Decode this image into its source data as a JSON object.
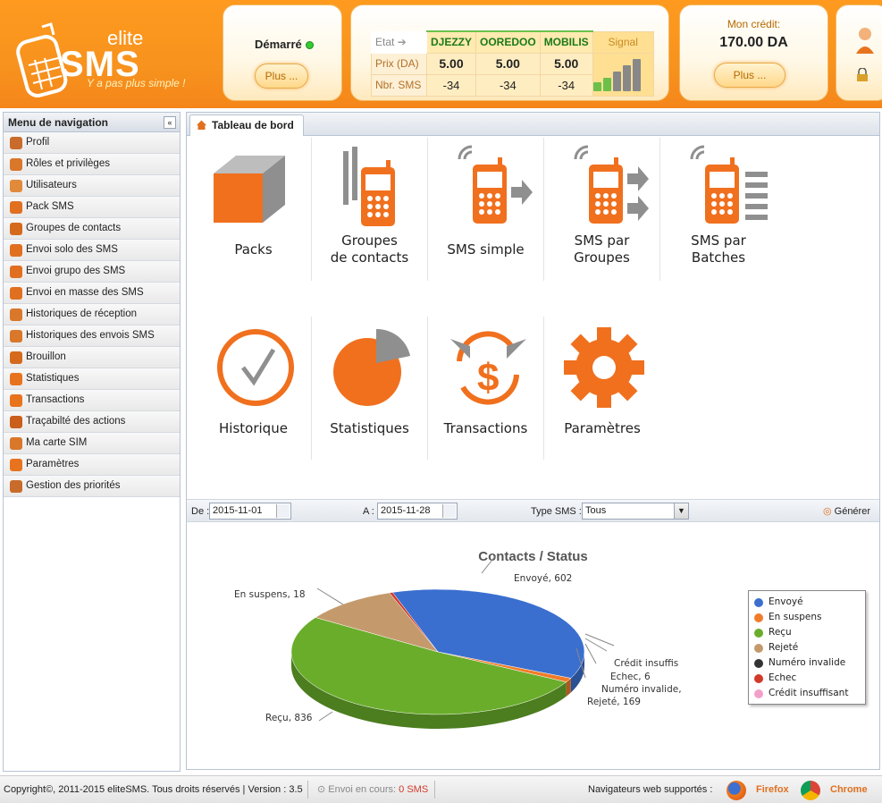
{
  "header": {
    "logo_small": "elite",
    "logo_big": "SMS",
    "tagline": "Y a pas plus simple !",
    "status_label": "Démarré",
    "status_more": "Plus ...",
    "operators": {
      "etat_label": "Etat",
      "names": [
        "DJEZZY",
        "OOREDOO",
        "MOBILIS"
      ],
      "signal_label": "Signal",
      "prix_label": "Prix (DA)",
      "prix": [
        "5.00",
        "5.00",
        "5.00"
      ],
      "nbr_label": "Nbr. SMS",
      "nbr": [
        "-34",
        "-34",
        "-34"
      ]
    },
    "credit_label": "Mon crédit:",
    "credit_value": "170.00 DA",
    "credit_more": "Plus ..."
  },
  "nav": {
    "title": "Menu de navigation",
    "collapse_glyph": "«",
    "items": [
      {
        "label": "Profil",
        "color": "#c96b2a"
      },
      {
        "label": "Rôles et privilèges",
        "color": "#d9772b"
      },
      {
        "label": "Utilisateurs",
        "color": "#e08a3a"
      },
      {
        "label": "Pack SMS",
        "color": "#e07020"
      },
      {
        "label": "Groupes de contacts",
        "color": "#d66a1c"
      },
      {
        "label": "Envoi solo des SMS",
        "color": "#e07020"
      },
      {
        "label": "Envoi grupo des SMS",
        "color": "#e07020"
      },
      {
        "label": "Envoi en masse des SMS",
        "color": "#e07020"
      },
      {
        "label": "Historiques de réception",
        "color": "#d9772b"
      },
      {
        "label": "Historiques des envois SMS",
        "color": "#d9772b"
      },
      {
        "label": "Brouillon",
        "color": "#d66a1c"
      },
      {
        "label": "Statistiques",
        "color": "#e8731e"
      },
      {
        "label": "Transactions",
        "color": "#e8731e"
      },
      {
        "label": "Traçabilté des actions",
        "color": "#c95f1a"
      },
      {
        "label": "Ma carte SIM",
        "color": "#d9772b"
      },
      {
        "label": "Paramètres",
        "color": "#e8731e"
      },
      {
        "label": "Gestion des priorités",
        "color": "#c96b2a"
      }
    ]
  },
  "main": {
    "tab": "Tableau de bord",
    "tiles": [
      {
        "label1": "Packs",
        "label2": ""
      },
      {
        "label1": "Groupes",
        "label2": "de contacts"
      },
      {
        "label1": "SMS simple",
        "label2": ""
      },
      {
        "label1": "SMS par",
        "label2": "Groupes"
      },
      {
        "label1": "SMS par",
        "label2": "Batches"
      },
      {
        "label1": "Historique",
        "label2": ""
      },
      {
        "label1": "Statistiques",
        "label2": ""
      },
      {
        "label1": "Transactions",
        "label2": ""
      },
      {
        "label1": "Paramètres",
        "label2": ""
      }
    ],
    "filters": {
      "from_label": "De :",
      "from_value": "2015-11-01",
      "to_label": "A :",
      "to_value": "2015-11-28",
      "type_label": "Type SMS :",
      "type_value": "Tous",
      "generate": "Générer"
    }
  },
  "chart_data": {
    "type": "pie",
    "title": "Contacts / Status",
    "slices": [
      {
        "label": "Envoyé",
        "value": 602,
        "color": "#3a6fcf"
      },
      {
        "label": "En suspens",
        "value": 18,
        "color": "#f07c2a"
      },
      {
        "label": "Reçu",
        "value": 836,
        "color": "#6aad2b"
      },
      {
        "label": "Rejeté",
        "value": 169,
        "color": "#c49a6c"
      },
      {
        "label": "Numéro invalide",
        "value": 0,
        "color": "#333333"
      },
      {
        "label": "Echec",
        "value": 6,
        "color": "#d23a2a"
      },
      {
        "label": "Crédit insuffisant",
        "value": 0,
        "color": "#f2a0c8"
      }
    ],
    "callouts": {
      "envoye": "Envoyé, 602",
      "suspens": "En suspens, 18",
      "recu": "Reçu, 836",
      "rejete": "Rejeté, 169",
      "invalide": "Numéro invalide,",
      "echec": "Echec, 6",
      "credit": "Crédit insuffis"
    },
    "legend_position": "right"
  },
  "footer": {
    "copyright": "Copyright©, 2011-2015 eliteSMS. Tous droits réservés | Version : 3.5",
    "envoi_label": "Envoi en cours:",
    "envoi_value": "0 SMS",
    "browsers_label": "Navigateurs web supportés :",
    "firefox": "Firefox",
    "chrome": "Chrome"
  }
}
